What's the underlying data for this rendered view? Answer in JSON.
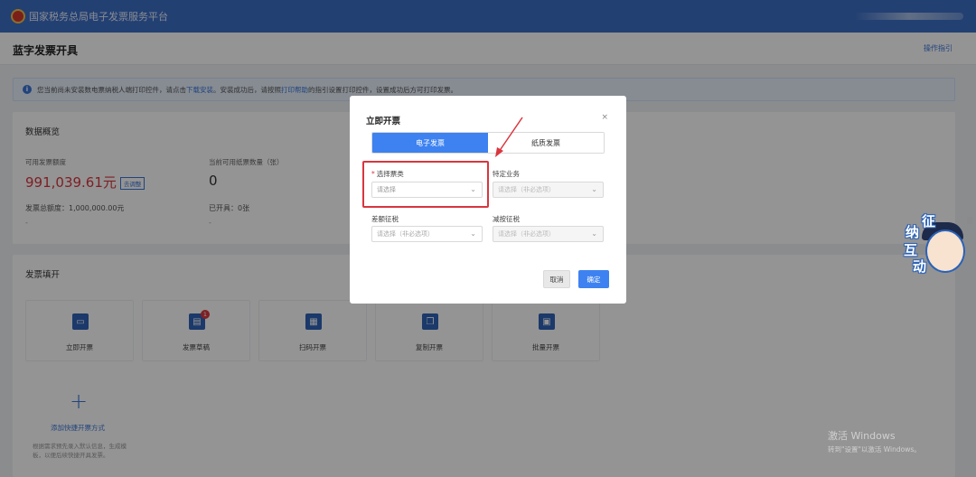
{
  "topbar": {
    "title": "国家税务总局电子发票服务平台"
  },
  "header": {
    "page_title": "蓝字发票开具",
    "guide_link": "操作指引"
  },
  "notice": {
    "text_1": "您当前尚未安装数电票纳税人端打印控件，请点击",
    "link_download": "下载安装",
    "text_2": "。安装成功后，请按照",
    "link_help": "打印帮助",
    "text_3": "的指引设置打印控件，设置成功后方可打印发票。"
  },
  "overview": {
    "title": "数据概览",
    "available_amount_label": "可用发票额度",
    "available_amount_value": "991,039.61元",
    "adjust_badge": "去调整",
    "paper_count_label": "当前可用纸票数量（张）",
    "paper_count_value": "0",
    "total_amount_text": "发票总额度：1,000,000.00元",
    "issued_text": "已开具：0张",
    "dash_1": "-",
    "dash_2": "-"
  },
  "invoice_fill": {
    "title": "发票填开",
    "tiles": [
      {
        "label": "立即开票",
        "icon": "invoice-icon"
      },
      {
        "label": "发票草稿",
        "icon": "draft-icon",
        "badge": "1"
      },
      {
        "label": "扫码开票",
        "icon": "qrcode-icon"
      },
      {
        "label": "复制开票",
        "icon": "copy-icon"
      },
      {
        "label": "批量开票",
        "icon": "batch-icon"
      }
    ],
    "add_label": "添加快捷开票方式",
    "add_desc": "根据需求预先录入默认信息，生成模板，以便后续快捷开具发票。"
  },
  "modal": {
    "title": "立即开票",
    "close": "×",
    "tabs": [
      {
        "label": "电子发票",
        "active": true
      },
      {
        "label": "纸质发票",
        "active": false
      }
    ],
    "fields": {
      "invoice_type": {
        "label": "选择票类",
        "required_mark": "*",
        "placeholder": "请选择"
      },
      "special_business": {
        "label": "特定业务",
        "placeholder": "请选择（非必选项）"
      },
      "differential_tax": {
        "label": "差额征税",
        "placeholder": "请选择（非必选项）"
      },
      "reduced_tax": {
        "label": "减按征税",
        "placeholder": "请选择（非必选项）"
      }
    },
    "cancel_button": "取消",
    "confirm_button": "确定"
  },
  "mascot": {
    "chars": [
      "征",
      "纳",
      "互",
      "动"
    ]
  },
  "watermark": {
    "line1": "激活 Windows",
    "line2": "转到\"设置\"以激活 Windows。"
  },
  "colors": {
    "topbar": "#3d6fc7",
    "primary": "#3d82f0",
    "danger": "#d9363e"
  }
}
